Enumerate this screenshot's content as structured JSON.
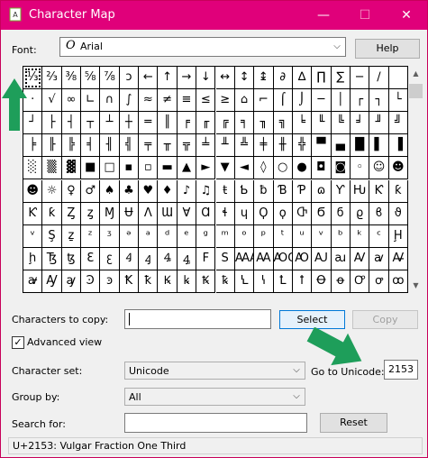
{
  "window": {
    "title": "Character Map"
  },
  "font": {
    "label": "Font:",
    "value": "Arial",
    "help_label": "Help"
  },
  "grid": {
    "columns": 20,
    "selected_index": 0,
    "rows": [
      [
        "⅓",
        "⅔",
        "⅜",
        "⅝",
        "⅞",
        "ↄ",
        "←",
        "↑",
        "→",
        "↓",
        "↔",
        "↕",
        "↨",
        "∂",
        "∆",
        "∏",
        "∑",
        "−",
        "∕",
        ""
      ],
      [
        "·",
        "√",
        "∞",
        "∟",
        "∩",
        "∫",
        "≈",
        "≠",
        "≡",
        "≤",
        "≥",
        "⌂",
        "⌐",
        "⌠",
        "⌡",
        "─",
        "│",
        "┌",
        "┐",
        "└"
      ],
      [
        "┘",
        "├",
        "┤",
        "┬",
        "┴",
        "┼",
        "═",
        "║",
        "╒",
        "╓",
        "╔",
        "╕",
        "╖",
        "╗",
        "╘",
        "╙",
        "╚",
        "╛",
        "╜",
        "╝"
      ],
      [
        "╞",
        "╟",
        "╠",
        "╡",
        "╢",
        "╣",
        "╤",
        "╥",
        "╦",
        "╧",
        "╨",
        "╩",
        "╪",
        "╫",
        "╬",
        "▀",
        "▄",
        "█",
        "▌",
        "▐"
      ],
      [
        "░",
        "▒",
        "▓",
        "■",
        "□",
        "▪",
        "▫",
        "▬",
        "▲",
        "►",
        "▼",
        "◄",
        "◊",
        "○",
        "●",
        "◘",
        "◙",
        "◦",
        "☺",
        "☻"
      ],
      [
        "☻",
        "☼",
        "♀",
        "♂",
        "♠",
        "♣",
        "♥",
        "♦",
        "♪",
        "♫",
        "ŧ",
        "Ƅ",
        "ƀ",
        "Ɓ",
        "Ƥ",
        "ɷ",
        "Ƴ",
        "Ƕ",
        "Ƙ",
        "ƙ"
      ],
      [
        "Ƙ",
        "ƙ",
        "Ȥ",
        "ȥ",
        "Ɱ",
        "Ʉ",
        "Ʌ",
        "Ɯ",
        "Ɐ",
        "Ɑ",
        "ɬ",
        "ɥ",
        "Ϙ",
        "ϙ",
        "Ⴇ",
        "Ϭ",
        "ϭ",
        "ϱ",
        "ϐ",
        "ϑ"
      ],
      [
        "ᵛ",
        "Ş",
        "ẕ",
        "ᶻ",
        "ᶾ",
        "ᵊ",
        "ᵃ",
        "ᵈ",
        "ᵉ",
        "ᵍ",
        "ᵐ",
        "ᵒ",
        "ᵖ",
        "ᵗ",
        "ᵘ",
        "ᵛ",
        "ᵇ",
        "ᵏ",
        "ᶜ",
        "Ḩ"
      ],
      [
        "ḩ",
        "Ꜩ",
        "ꜩ",
        "Ꜫ",
        "ꜫ",
        "Ꜭ",
        "ꜭ",
        "Ꜯ",
        "ꜯ",
        "F",
        "S",
        "ꜲA",
        "Ꜳ",
        "ꜴO",
        "Ꜵ",
        "Ꜷ",
        "ꜷ",
        "Ꜹ",
        "ꜹ",
        "Ꜻ"
      ],
      [
        "ꜻ",
        "Ꜽ",
        "ꜽ",
        "Ꜿ",
        "ꜿ",
        "Ꝁ",
        "ꝁ",
        "Ꝃ",
        "ꝃ",
        "Ꝅ",
        "ꝅ",
        "Ꝇ",
        "ꝇ",
        "Ꝉ",
        "ꝉ",
        "Ꝋ",
        "ꝋ",
        "Ꝍ",
        "ꝍ",
        "ꝏ"
      ]
    ]
  },
  "copy": {
    "label": "Characters to copy:",
    "value": "",
    "select_label": "Select",
    "copy_label": "Copy"
  },
  "advanced": {
    "label": "Advanced view",
    "checked": true
  },
  "charset": {
    "label": "Character set:",
    "value": "Unicode"
  },
  "goto": {
    "label": "Go to Unicode:",
    "value": "2153"
  },
  "group": {
    "label": "Group by:",
    "value": "All"
  },
  "search": {
    "label": "Search for:",
    "value": "",
    "reset_label": "Reset"
  },
  "status": {
    "text": "U+2153: Vulgar Fraction One Third"
  },
  "colors": {
    "titlebar": "#e0007a",
    "annotation_arrow": "#1e9e5a"
  }
}
